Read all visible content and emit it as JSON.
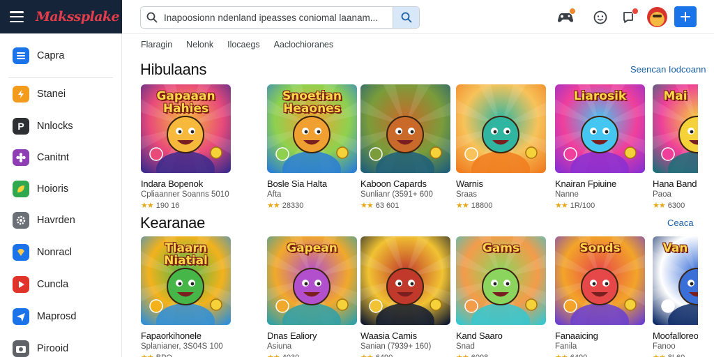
{
  "brand": {
    "logo": "Makssplake"
  },
  "search": {
    "placeholder": "Inapoosionn ndenland ipeasses coniomal laanam..."
  },
  "sidebar": {
    "items": [
      {
        "label": "Capra",
        "icon": "list-icon",
        "color": "#1a73e8"
      },
      {
        "label": "Stanei",
        "icon": "bolt-icon",
        "color": "#f29b1d"
      },
      {
        "label": "Nnlocks",
        "icon": "p-icon",
        "color": "#2d2f33"
      },
      {
        "label": "Canitnt",
        "icon": "flower-icon",
        "color": "#8e3fb3"
      },
      {
        "label": "Hoioris",
        "icon": "leaf-icon",
        "color": "#2fa84f"
      },
      {
        "label": "Havrden",
        "icon": "gear-icon",
        "color": "#6b7077"
      },
      {
        "label": "Nonracl",
        "icon": "gem-icon",
        "color": "#1a73e8"
      },
      {
        "label": "Cuncla",
        "icon": "play-icon",
        "color": "#e0342b"
      },
      {
        "label": "Maprosd",
        "icon": "send-icon",
        "color": "#1a73e8"
      },
      {
        "label": "Pirooid",
        "icon": "camera-icon",
        "color": "#5f6368"
      }
    ]
  },
  "topbar": {
    "icons": [
      "gamepad-icon",
      "face-icon",
      "notification-icon"
    ],
    "create_icon": "plus-icon"
  },
  "tabs": [
    "Flaragin",
    "Nelonk",
    "Ilocaegs",
    "Aaclochioranes"
  ],
  "sections": [
    {
      "title": "Hibulaans",
      "link": "Seencan Iodcoann",
      "cards": [
        {
          "title": "Indara Bopenok",
          "sub": "Cpliaanner Soanns 5010",
          "rating": "190 16",
          "art": "Gapaaan Hahies",
          "palette": [
            "#3c2a8c",
            "#e84a7a",
            "#f6b93b"
          ]
        },
        {
          "title": "Bosle Sia Halta",
          "sub": "Afta",
          "rating": "28330",
          "art": "Snoetian Heaones",
          "palette": [
            "#2a7fd4",
            "#8fd14f",
            "#f0a030"
          ]
        },
        {
          "title": "Kaboon Capards",
          "sub": "Sunlianr (3591+ 600",
          "rating": "63 601",
          "art": "",
          "palette": [
            "#1f5f7a",
            "#7a9c3a",
            "#c96a2a"
          ]
        },
        {
          "title": "Warnis",
          "sub": "Sraas",
          "rating": "18800",
          "art": "",
          "palette": [
            "#f07c1f",
            "#f7c35a",
            "#2fb5a0"
          ]
        },
        {
          "title": "Knairan Fpiuine",
          "sub": "Nanne",
          "rating": "1R/100",
          "art": "Liarosik",
          "palette": [
            "#8a2fd1",
            "#f03f9c",
            "#45c6f0"
          ]
        },
        {
          "title": "Hana Band",
          "sub": "Paoa",
          "rating": "6300",
          "art": "Mai",
          "palette": [
            "#1c6f78",
            "#ee3f9a",
            "#f6d23a"
          ]
        }
      ]
    },
    {
      "title": "Kearanae",
      "link": "Ceaca",
      "cards": [
        {
          "title": "Fapaorkihonele",
          "sub": "Splanianer, 3S04S 100",
          "rating": "BPQ",
          "art": "Tlaarn Niatial",
          "palette": [
            "#2f8fd8",
            "#f3b21c",
            "#46b649"
          ]
        },
        {
          "title": "Dnas Ealiory",
          "sub": "Asiuna",
          "rating": "4030",
          "art": "Gapean",
          "palette": [
            "#2fa0a8",
            "#f1a92b",
            "#b24fcc"
          ]
        },
        {
          "title": "Waasia Camis",
          "sub": "Sanian (7939+ 160)",
          "rating": "6490",
          "art": "",
          "palette": [
            "#101a30",
            "#f1c232",
            "#c0392b"
          ]
        },
        {
          "title": "Kand Saaro",
          "sub": "Snad",
          "rating": "6098",
          "art": "Gams",
          "palette": [
            "#36c7d0",
            "#f39c4a",
            "#8bd45e"
          ]
        },
        {
          "title": "Fanaaicing",
          "sub": "Fanila",
          "rating": "6490",
          "art": "Sonds",
          "palette": [
            "#6a3fd0",
            "#f3a429",
            "#e6484a"
          ]
        },
        {
          "title": "Moofalloreo",
          "sub": "Fanoo",
          "rating": "8L60",
          "art": "Van",
          "palette": [
            "#0c2a66",
            "#ffffff",
            "#3a6fd8"
          ]
        }
      ]
    }
  ]
}
